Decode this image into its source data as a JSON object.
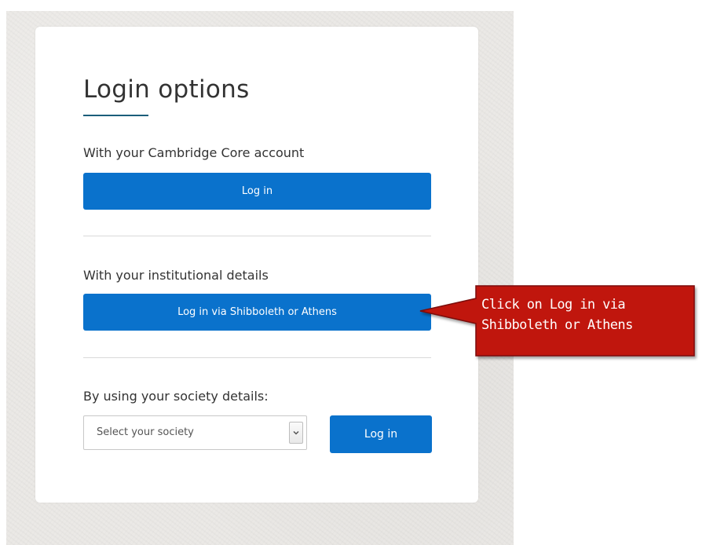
{
  "card": {
    "title": "Login options",
    "cambridge_section": {
      "label": "With your Cambridge Core account",
      "button_label": "Log in"
    },
    "institution_section": {
      "label": "With your institutional details",
      "button_label": "Log in via Shibboleth or Athens"
    },
    "society_section": {
      "label": "By using your society details:",
      "select_value": "Select your society",
      "button_label": "Log in"
    }
  },
  "annotation": {
    "line1": "Click on Log in via",
    "line2": "Shibboleth or Athens",
    "fill_color": "#c0140c",
    "border_color": "#7a0d07"
  },
  "colors": {
    "primary_button": "#0a72cc",
    "title_underline": "#1b5e7a"
  },
  "icons": {
    "select_arrow": "chevron-down-icon"
  }
}
